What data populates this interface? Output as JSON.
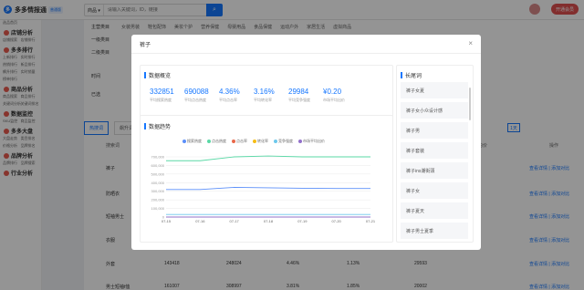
{
  "app": {
    "logo_mark": "多",
    "logo_text": "多多情报通",
    "logo_badge": "普通版"
  },
  "search": {
    "category": "商品 ▾",
    "placeholder": "请输入关键词，ID，链接"
  },
  "user": {
    "name": "",
    "vip_label": "开通会员"
  },
  "sidebar": {
    "groups": [
      {
        "title": "",
        "items": [
          "选品首页"
        ]
      },
      {
        "title": "店铺分析",
        "items": [
          "店铺搜索",
          "店铺排行"
        ]
      },
      {
        "title": "多多排行",
        "items": [
          "上新排行",
          "实时排行",
          "热销排行",
          "新品排行",
          "飙升排行",
          "实时销量",
          "榜单排行"
        ]
      },
      {
        "title": "商品分析",
        "items": [
          "商品搜索",
          "商品排行",
          "关键词分析",
          "关键词排名"
        ]
      },
      {
        "title": "数据监控",
        "items": [
          "SKU监控",
          "商品监控"
        ]
      },
      {
        "title": "多多大盘",
        "items": [
          "大盘走势",
          "类目排名",
          "价格分析",
          "品牌排名"
        ]
      },
      {
        "title": "品牌分析",
        "items": [
          "品牌排行",
          "品牌搜索"
        ]
      },
      {
        "title": "行业分析",
        "items": []
      }
    ]
  },
  "main": {
    "row1_label": "主营类目",
    "row1": [
      "女装男装",
      "鞋包配饰",
      "美妆个护",
      "营养保健",
      "母婴用品",
      "食品保健",
      "运动户外",
      "家居生活",
      "虚拟商品"
    ],
    "row2_label": "一级类目",
    "row3_label": "二级类目",
    "row4_label": "时间",
    "row5_label": "已选",
    "tabs": [
      "热搜词",
      "飙升词"
    ],
    "pager": "1天",
    "col_keyword": "搜索词",
    "col_price": "均价",
    "col_op": "操作",
    "rows": [
      {
        "kw": "裤子",
        "op": "查看详情 | 添加对比"
      },
      {
        "kw": "防晒衣",
        "op": "查看详情 | 添加对比"
      },
      {
        "kw": "短袖男士",
        "op": "查看详情 | 添加对比"
      },
      {
        "kw": "衣服",
        "op": "查看详情 | 添加对比"
      },
      {
        "kw": "外套",
        "a": "143418",
        "b": "248024",
        "c": "4.46%",
        "d": "1.13%",
        "e": "29593",
        "op": "查看详情 | 添加对比"
      },
      {
        "kw": "男士短袖t恤",
        "a": "161007",
        "b": "308997",
        "c": "3.81%",
        "d": "1.85%",
        "e": "20002",
        "op": "查看详情 | 添加对比"
      }
    ]
  },
  "modal": {
    "title": "裤子",
    "close": "×",
    "overview_title": "数据概览",
    "stats": [
      {
        "value": "332851",
        "label": "平均搜索热度"
      },
      {
        "value": "690088",
        "label": "平均点击热度"
      },
      {
        "value": "4.36%",
        "label": "平均点击率"
      },
      {
        "value": "3.16%",
        "label": "平均转化率"
      },
      {
        "value": "29984",
        "label": "平均竞争强度"
      },
      {
        "value": "¥0.20",
        "label": "市场平均出价"
      }
    ],
    "trend_title": "数据趋势",
    "tail_title": "长尾词",
    "tail_words": [
      "裤子女夏",
      "裤子女小众设计感",
      "裤子男",
      "裤子套装",
      "裤子ins潮街頭",
      "裤子女",
      "裤子夏天",
      "裤子男士夏季"
    ]
  },
  "chart_data": {
    "type": "line",
    "x": [
      "07-15",
      "07-16",
      "07-17",
      "07-18",
      "07-19",
      "07-20",
      "07-21"
    ],
    "ylim": [
      0,
      700000
    ],
    "yticks": [
      "0",
      "100,000",
      "200,000",
      "300,000",
      "400,000",
      "500,000",
      "600,000",
      "700,000"
    ],
    "series": [
      {
        "name": "搜索热度",
        "color": "#5b8ff9",
        "values": [
          320000,
          320000,
          345000,
          340000,
          335000,
          332000,
          332000
        ]
      },
      {
        "name": "点击热度",
        "color": "#5ad8a6",
        "values": [
          655000,
          655000,
          700000,
          710000,
          700000,
          700000,
          700000
        ]
      },
      {
        "name": "点击率",
        "color": "#e8684a",
        "values": [
          4,
          4,
          4,
          4,
          4,
          4,
          4
        ]
      },
      {
        "name": "转化率",
        "color": "#f6bd16",
        "values": [
          3,
          3,
          3,
          3,
          3,
          3,
          3
        ]
      },
      {
        "name": "竞争强度",
        "color": "#6dc8ec",
        "values": [
          30000,
          30000,
          30000,
          30000,
          30000,
          30000,
          30000
        ]
      },
      {
        "name": "市场平均出价",
        "color": "#9270ca",
        "values": [
          0.2,
          0.2,
          0.2,
          0.2,
          0.2,
          0.2,
          0.2
        ]
      }
    ]
  }
}
